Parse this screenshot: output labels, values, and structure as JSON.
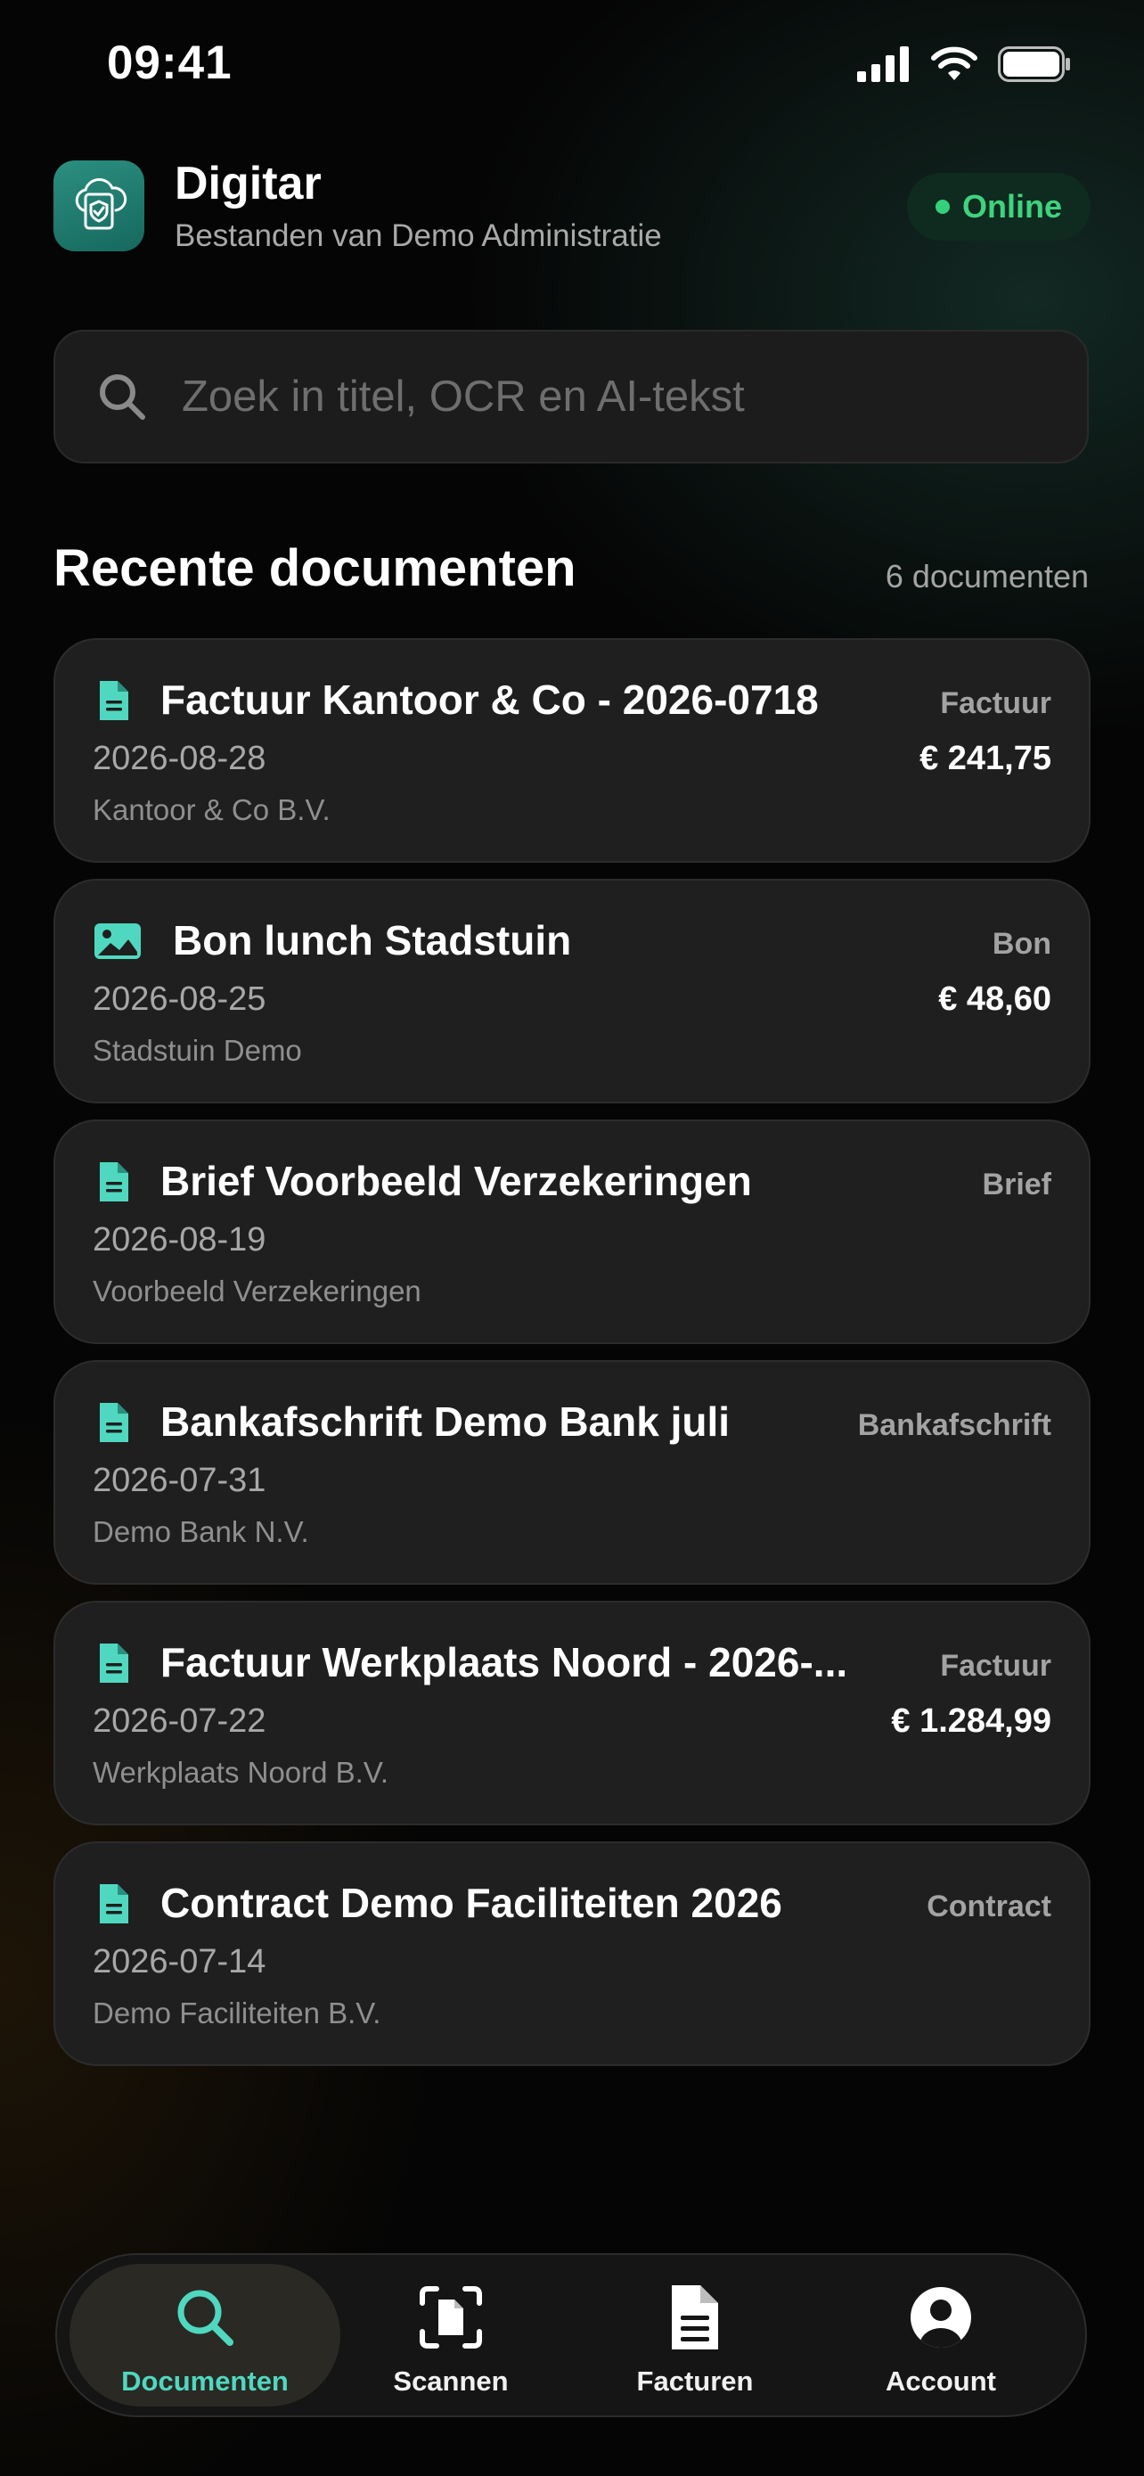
{
  "status_bar": {
    "time": "09:41"
  },
  "header": {
    "app_name": "Digitar",
    "subtitle": "Bestanden van Demo Administratie",
    "status_badge": "Online",
    "accent": "#2b8f80"
  },
  "search": {
    "placeholder": "Zoek in titel, OCR en AI-tekst",
    "value": ""
  },
  "section": {
    "title": "Recente documenten",
    "count": "6 documenten"
  },
  "documents": [
    {
      "icon": "document-icon",
      "title": "Factuur Kantoor & Co - 2026-0718",
      "type": "Factuur",
      "date": "2026-08-28",
      "amount": "€ 241,75",
      "company": "Kantoor & Co B.V."
    },
    {
      "icon": "image-icon",
      "title": "Bon lunch Stadstuin",
      "type": "Bon",
      "date": "2026-08-25",
      "amount": "€ 48,60",
      "company": "Stadstuin Demo"
    },
    {
      "icon": "document-icon",
      "title": "Brief Voorbeeld Verzekeringen",
      "type": "Brief",
      "date": "2026-08-19",
      "amount": "",
      "company": "Voorbeeld Verzekeringen"
    },
    {
      "icon": "document-icon",
      "title": "Bankafschrift Demo Bank juli",
      "type": "Bankafschrift",
      "date": "2026-07-31",
      "amount": "",
      "company": "Demo Bank N.V."
    },
    {
      "icon": "document-icon",
      "title": "Factuur Werkplaats Noord - 2026-...",
      "type": "Factuur",
      "date": "2026-07-22",
      "amount": "€ 1.284,99",
      "company": "Werkplaats Noord B.V."
    },
    {
      "icon": "document-icon",
      "title": "Contract Demo Faciliteiten 2026",
      "type": "Contract",
      "date": "2026-07-14",
      "amount": "",
      "company": "Demo Faciliteiten B.V."
    }
  ],
  "tabs": [
    {
      "label": "Documenten",
      "icon": "search-icon",
      "active": true
    },
    {
      "label": "Scannen",
      "icon": "scan-icon",
      "active": false
    },
    {
      "label": "Facturen",
      "icon": "invoice-icon",
      "active": false
    },
    {
      "label": "Account",
      "icon": "account-icon",
      "active": false
    }
  ],
  "colors": {
    "accent_teal": "#4fd8bf",
    "online_green": "#3ed37e",
    "card_bg": "#1f1f1f"
  }
}
